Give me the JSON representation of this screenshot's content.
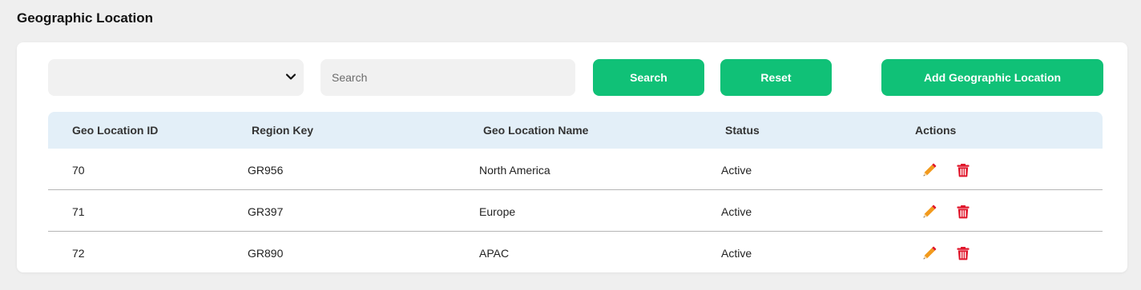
{
  "page": {
    "title": "Geographic Location"
  },
  "toolbar": {
    "select_value": "",
    "search_placeholder": "Search",
    "search_value": "",
    "search_label": "Search",
    "reset_label": "Reset",
    "add_label": "Add Geographic Location"
  },
  "table": {
    "headers": {
      "id": "Geo Location ID",
      "region_key": "Region Key",
      "name": "Geo Location Name",
      "status": "Status",
      "actions": "Actions"
    },
    "rows": [
      {
        "id": "70",
        "region_key": "GR956",
        "name": "North America",
        "status": "Active"
      },
      {
        "id": "71",
        "region_key": "GR397",
        "name": "Europe",
        "status": "Active"
      },
      {
        "id": "72",
        "region_key": "GR890",
        "name": "APAC",
        "status": "Active"
      }
    ]
  },
  "icons": {
    "select_chevron": "chevron-down-icon",
    "edit": "pencil-icon",
    "delete": "trash-icon"
  },
  "colors": {
    "primary_button": "#10c177",
    "table_header_bg": "#e3eff8",
    "edit_icon": "#f29a1d",
    "delete_icon": "#e0162b"
  }
}
